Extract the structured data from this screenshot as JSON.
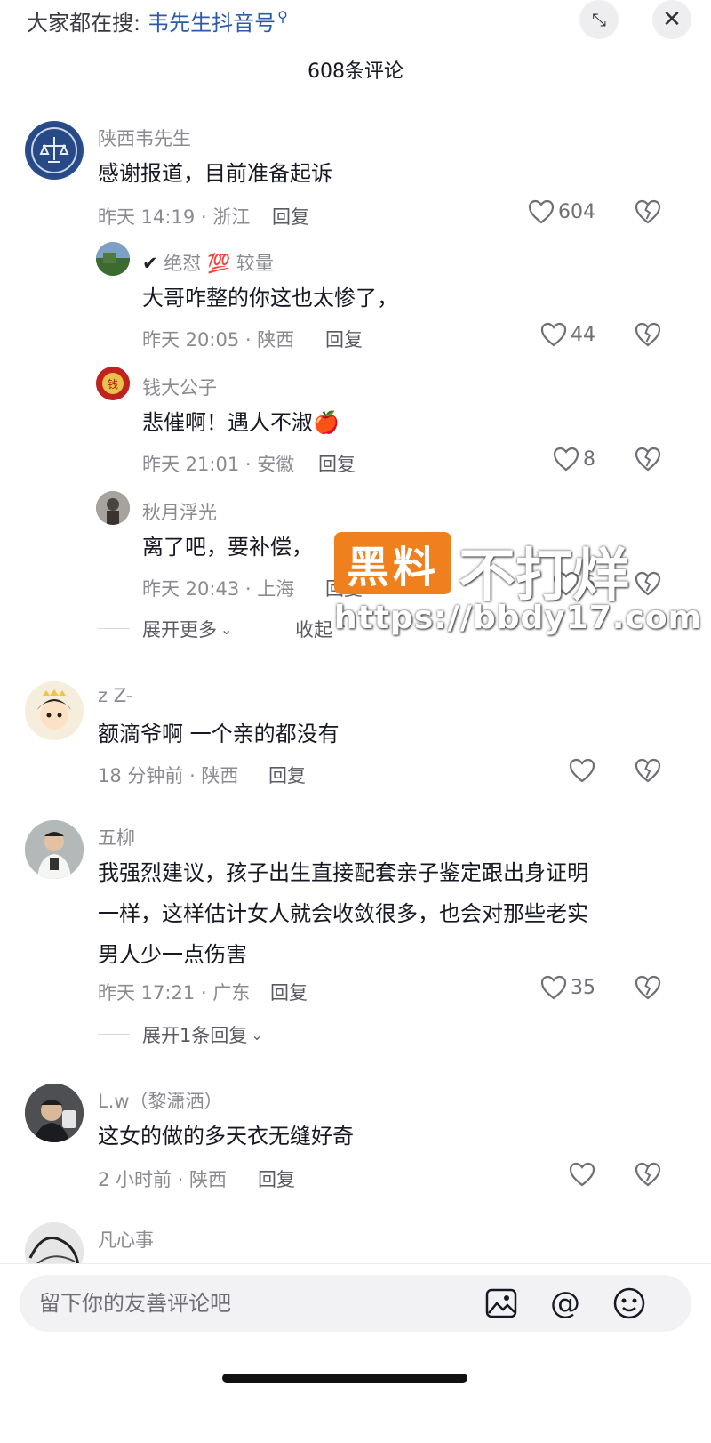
{
  "search": {
    "prefix": "大家都在搜:",
    "keyword": "韦先生抖音号"
  },
  "header": {
    "comment_count": "608条评论"
  },
  "comments": [
    {
      "user": "陕西韦先生",
      "text": "感谢报道，目前准备起诉",
      "time": "昨天 14:19 · 浙江",
      "reply": "回复",
      "likes": "604",
      "replies": [
        {
          "user_badge": "✔",
          "user": "绝怼",
          "user_emoji": "💯",
          "user_suffix": "较量",
          "text": "大哥咋整的你这也太惨了，",
          "time": "昨天 20:05 · 陕西",
          "reply": "回复",
          "likes": "44"
        },
        {
          "user": "钱大公子",
          "text": "悲催啊！遇人不淑",
          "text_emoji": "🍎",
          "time": "昨天 21:01 · 安徽",
          "reply": "回复",
          "likes": "8"
        },
        {
          "user": "秋月浮光",
          "text": "离了吧，要补偿，",
          "time": "昨天 20:43 · 上海",
          "reply": "回复",
          "likes": "6"
        }
      ],
      "expand_more": "展开更多",
      "collapse": "收起"
    },
    {
      "user": "z Z-",
      "text": "额滴爷啊 一个亲的都没有",
      "time": "18 分钟前 · 陕西",
      "reply": "回复",
      "likes": ""
    },
    {
      "user": "五柳",
      "text_lines": [
        "我强烈建议，孩子出生直接配套亲子鉴定跟出身证明",
        "一样，这样估计女人就会收敛很多，也会对那些老实",
        "男人少一点伤害"
      ],
      "time": "昨天 17:21 · 广东",
      "reply": "回复",
      "likes": "35",
      "expand": "展开1条回复"
    },
    {
      "user": "L.w（黎潇洒）",
      "text": "这女的做的多天衣无缝好奇",
      "time": "2 小时前 · 陕西",
      "reply": "回复",
      "likes": ""
    },
    {
      "user": "凡心事"
    }
  ],
  "watermark": {
    "logo": "黑料",
    "title": "不打烊",
    "url": "https://bbdy17.com"
  },
  "input": {
    "placeholder": "留下你的友善评论吧"
  },
  "icons": {
    "image": "image-icon",
    "mention": "at-icon",
    "emoji": "smiley-icon"
  }
}
